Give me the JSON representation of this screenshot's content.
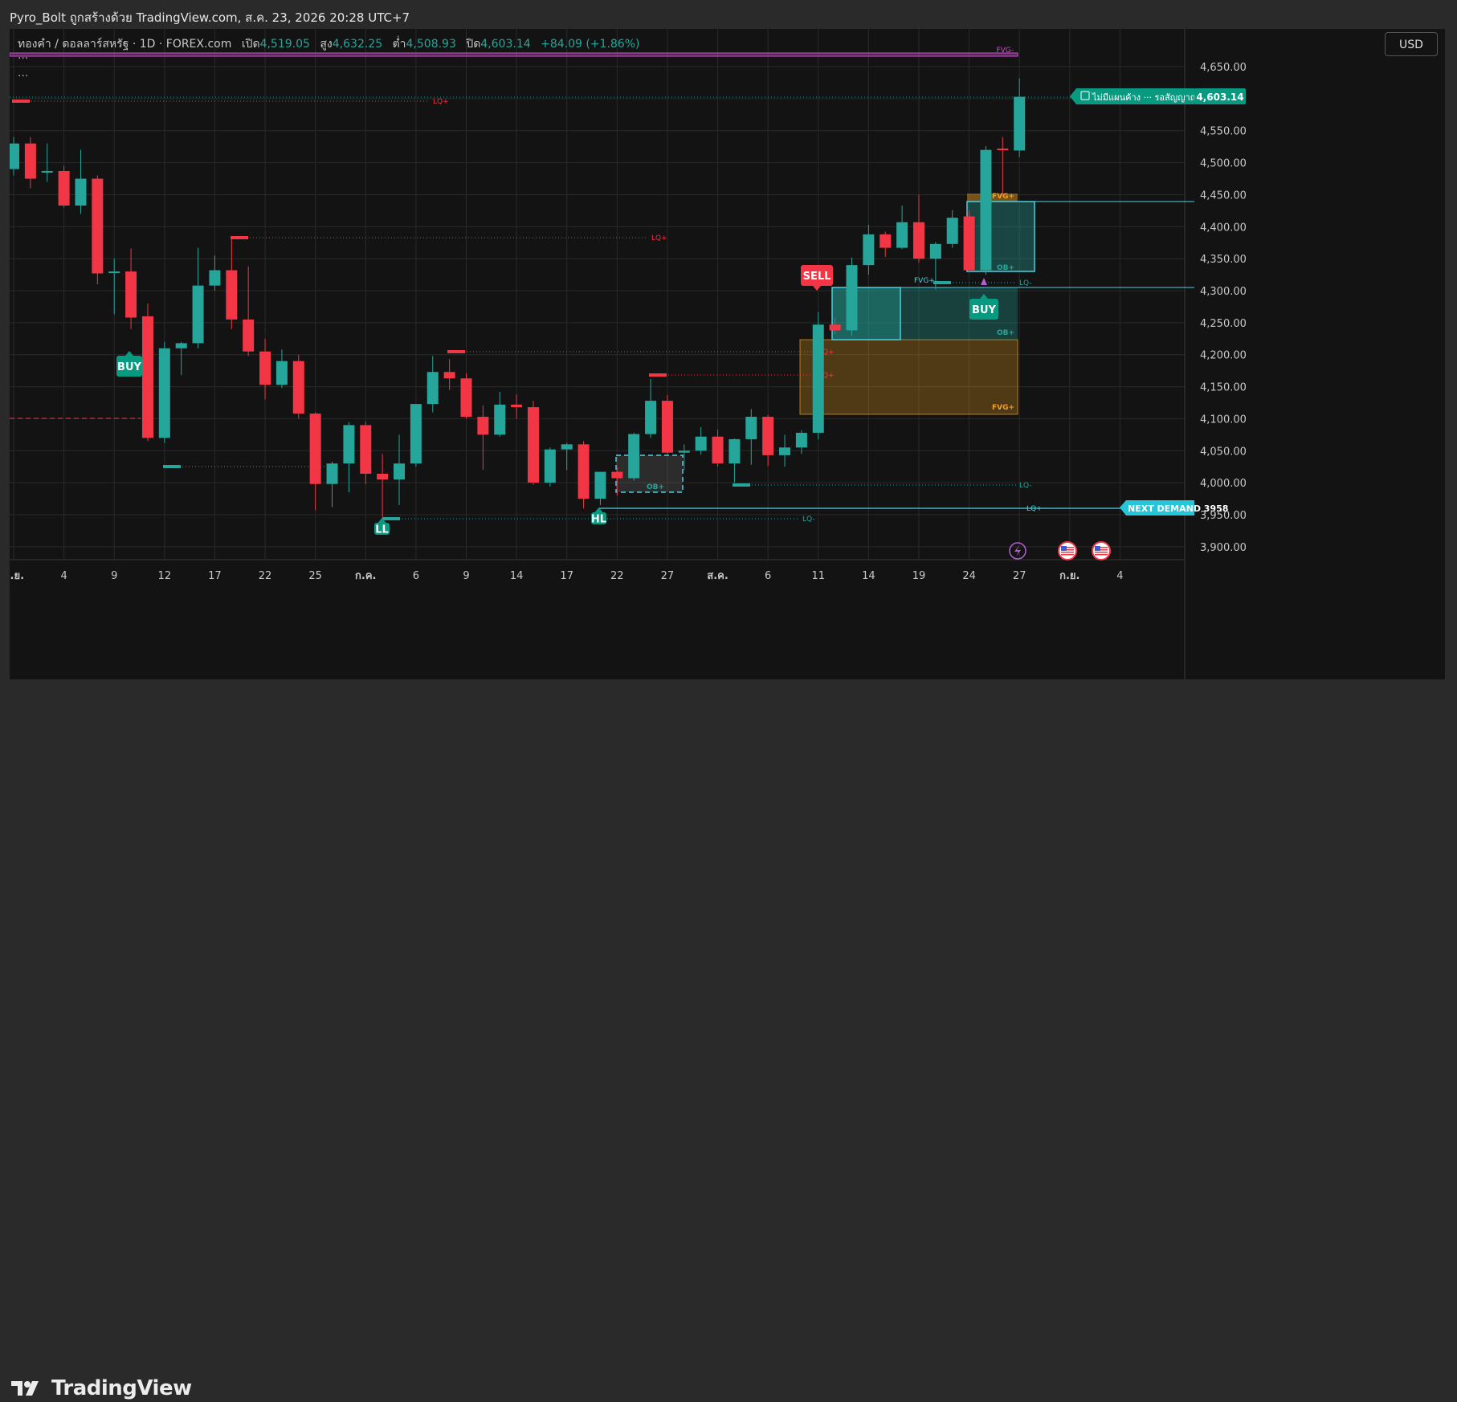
{
  "header": {
    "credit": "Pyro_Bolt ถูกสร้างด้วย TradingView.com, ส.ค. 23, 2026 20:28 UTC+7"
  },
  "legend": {
    "symbol": "ทองคำ / ดอลลาร์สหรัฐ · 1D · FOREX.com",
    "open_label": "เปิด",
    "open": "4,519.05",
    "high_label": "สูง",
    "high": "4,632.25",
    "low_label": "ต่ำ",
    "low": "4,508.93",
    "close_label": "ปิด",
    "close": "4,603.14",
    "change": "+84.09 (+1.86%)",
    "more": "···"
  },
  "currency_button": "USD",
  "footer": {
    "brand": "TradingView"
  },
  "colors": {
    "up": "#26a69a",
    "down": "#f23645",
    "buy": "#089981",
    "sell": "#f23645",
    "fvg_minus": "#d04fd0",
    "ob": "#26a69a",
    "fvg_orange": "#f0a020",
    "lq": "#5ec8ff"
  },
  "chart_data": {
    "type": "candlestick",
    "title": "ทองคำ / ดอลลาร์สหรัฐ · 1D · FOREX.com",
    "ylim": [
      3870,
      4700
    ],
    "y_ticks": [
      "4,650.00",
      "4,600.00",
      "4,550.00",
      "4,500.00",
      "4,450.00",
      "4,400.00",
      "4,350.00",
      "4,300.00",
      "4,250.00",
      "4,200.00",
      "4,150.00",
      "4,100.00",
      "4,050.00",
      "4,000.00",
      "3,950.00",
      "3,900.00"
    ],
    "x_ticks": [
      {
        "i": 0,
        "label": "มิ.ย."
      },
      {
        "i": 3,
        "label": "4"
      },
      {
        "i": 6,
        "label": "9"
      },
      {
        "i": 9,
        "label": "12"
      },
      {
        "i": 12,
        "label": "17"
      },
      {
        "i": 15,
        "label": "22"
      },
      {
        "i": 18,
        "label": "25"
      },
      {
        "i": 21,
        "label": "ก.ค."
      },
      {
        "i": 24,
        "label": "6"
      },
      {
        "i": 27,
        "label": "9"
      },
      {
        "i": 30,
        "label": "14"
      },
      {
        "i": 33,
        "label": "17"
      },
      {
        "i": 36,
        "label": "22"
      },
      {
        "i": 39,
        "label": "27"
      },
      {
        "i": 42,
        "label": "ส.ค."
      },
      {
        "i": 45,
        "label": "6"
      },
      {
        "i": 48,
        "label": "11"
      },
      {
        "i": 51,
        "label": "14"
      },
      {
        "i": 54,
        "label": "19"
      },
      {
        "i": 57,
        "label": "24"
      },
      {
        "i": 60,
        "label": "27"
      },
      {
        "i": 63,
        "label": "ก.ย."
      },
      {
        "i": 66,
        "label": "4"
      }
    ],
    "candles": [
      {
        "o": 4490,
        "h": 4540,
        "l": 4480,
        "c": 4530
      },
      {
        "o": 4530,
        "h": 4540,
        "l": 4460,
        "c": 4475
      },
      {
        "o": 4485,
        "h": 4530,
        "l": 4470,
        "c": 4487
      },
      {
        "o": 4487,
        "h": 4495,
        "l": 4430,
        "c": 4433
      },
      {
        "o": 4433,
        "h": 4520,
        "l": 4420,
        "c": 4475
      },
      {
        "o": 4475,
        "h": 4480,
        "l": 4310,
        "c": 4327
      },
      {
        "o": 4328,
        "h": 4350,
        "l": 4263,
        "c": 4330
      },
      {
        "o": 4330,
        "h": 4366,
        "l": 4240,
        "c": 4258
      },
      {
        "o": 4260,
        "h": 4280,
        "l": 4065,
        "c": 4070
      },
      {
        "o": 4070,
        "h": 4220,
        "l": 4062,
        "c": 4210
      },
      {
        "o": 4210,
        "h": 4220,
        "l": 4168,
        "c": 4218
      },
      {
        "o": 4218,
        "h": 4367,
        "l": 4210,
        "c": 4308
      },
      {
        "o": 4308,
        "h": 4355,
        "l": 4300,
        "c": 4332
      },
      {
        "o": 4332,
        "h": 4385,
        "l": 4240,
        "c": 4255
      },
      {
        "o": 4255,
        "h": 4338,
        "l": 4198,
        "c": 4205
      },
      {
        "o": 4205,
        "h": 4225,
        "l": 4130,
        "c": 4153
      },
      {
        "o": 4153,
        "h": 4208,
        "l": 4148,
        "c": 4190
      },
      {
        "o": 4190,
        "h": 4200,
        "l": 4100,
        "c": 4108
      },
      {
        "o": 4108,
        "h": 4110,
        "l": 3957,
        "c": 3998
      },
      {
        "o": 3998,
        "h": 4033,
        "l": 3962,
        "c": 4030
      },
      {
        "o": 4030,
        "h": 4095,
        "l": 3985,
        "c": 4090
      },
      {
        "o": 4090,
        "h": 4095,
        "l": 3998,
        "c": 4014
      },
      {
        "o": 4014,
        "h": 4045,
        "l": 3945,
        "c": 4005
      },
      {
        "o": 4005,
        "h": 4075,
        "l": 3965,
        "c": 4030
      },
      {
        "o": 4030,
        "h": 4123,
        "l": 4025,
        "c": 4123
      },
      {
        "o": 4123,
        "h": 4198,
        "l": 4110,
        "c": 4173
      },
      {
        "o": 4173,
        "h": 4193,
        "l": 4145,
        "c": 4163
      },
      {
        "o": 4163,
        "h": 4171,
        "l": 4100,
        "c": 4103
      },
      {
        "o": 4103,
        "h": 4121,
        "l": 4020,
        "c": 4075
      },
      {
        "o": 4075,
        "h": 4142,
        "l": 4072,
        "c": 4122
      },
      {
        "o": 4122,
        "h": 4138,
        "l": 4100,
        "c": 4118
      },
      {
        "o": 4118,
        "h": 4128,
        "l": 3997,
        "c": 4000
      },
      {
        "o": 4000,
        "h": 4055,
        "l": 3994,
        "c": 4052
      },
      {
        "o": 4052,
        "h": 4062,
        "l": 4020,
        "c": 4060
      },
      {
        "o": 4060,
        "h": 4065,
        "l": 3960,
        "c": 3975
      },
      {
        "o": 3975,
        "h": 4015,
        "l": 3965,
        "c": 4017
      },
      {
        "o": 4017,
        "h": 4024,
        "l": 3980,
        "c": 4007
      },
      {
        "o": 4007,
        "h": 4078,
        "l": 4003,
        "c": 4076
      },
      {
        "o": 4076,
        "h": 4162,
        "l": 4070,
        "c": 4128
      },
      {
        "o": 4128,
        "h": 4137,
        "l": 4045,
        "c": 4047
      },
      {
        "o": 4047,
        "h": 4060,
        "l": 4020,
        "c": 4050
      },
      {
        "o": 4050,
        "h": 4087,
        "l": 4044,
        "c": 4072
      },
      {
        "o": 4072,
        "h": 4083,
        "l": 4025,
        "c": 4030
      },
      {
        "o": 4030,
        "h": 4069,
        "l": 4000,
        "c": 4068
      },
      {
        "o": 4068,
        "h": 4115,
        "l": 4028,
        "c": 4103
      },
      {
        "o": 4103,
        "h": 4106,
        "l": 4026,
        "c": 4043
      },
      {
        "o": 4043,
        "h": 4075,
        "l": 4025,
        "c": 4055
      },
      {
        "o": 4055,
        "h": 4082,
        "l": 4045,
        "c": 4078
      },
      {
        "o": 4078,
        "h": 4267,
        "l": 4068,
        "c": 4247
      },
      {
        "o": 4247,
        "h": 4258,
        "l": 4232,
        "c": 4238
      },
      {
        "o": 4238,
        "h": 4352,
        "l": 4230,
        "c": 4340
      },
      {
        "o": 4340,
        "h": 4403,
        "l": 4325,
        "c": 4388
      },
      {
        "o": 4388,
        "h": 4392,
        "l": 4353,
        "c": 4367
      },
      {
        "o": 4367,
        "h": 4433,
        "l": 4365,
        "c": 4407
      },
      {
        "o": 4407,
        "h": 4450,
        "l": 4344,
        "c": 4350
      },
      {
        "o": 4350,
        "h": 4376,
        "l": 4302,
        "c": 4373
      },
      {
        "o": 4373,
        "h": 4426,
        "l": 4367,
        "c": 4414
      },
      {
        "o": 4416,
        "h": 4425,
        "l": 4330,
        "c": 4332
      },
      {
        "o": 4332,
        "h": 4526,
        "l": 4325,
        "c": 4520
      },
      {
        "o": 4522,
        "h": 4540,
        "l": 4450,
        "c": 4520
      },
      {
        "o": 4519,
        "h": 4632,
        "l": 4509,
        "c": 4603
      }
    ]
  },
  "annotations": {
    "fvg_minus": "FVG-",
    "lq_plus": "LQ+",
    "lq_minus": "LQ-",
    "fvg_plus": "FVG+",
    "ob_plus": "OB+",
    "buy": "BUY",
    "sell": "SELL",
    "ll": "LL",
    "hl": "HL",
    "price_badge": "4,603.14",
    "status_label": "ไม่มีแผนค้าง ··· รอสัญญาณเข้า",
    "next_demand": "NEXT DEMAND  3958"
  }
}
